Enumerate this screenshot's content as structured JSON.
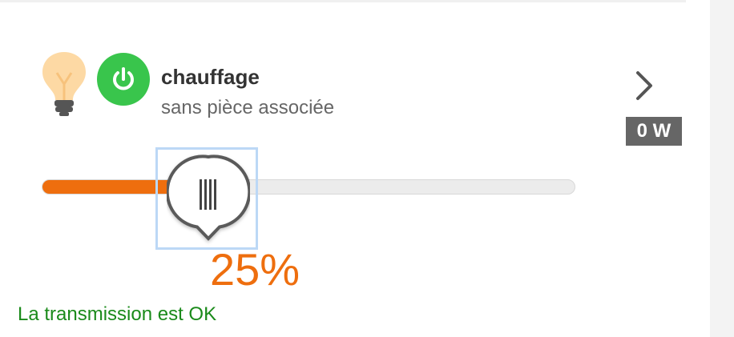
{
  "device": {
    "name": "chauffage",
    "room": "sans pièce associée",
    "power_reading": "0 W",
    "bulb_icon": "lightbulb-icon",
    "power_icon": "power-icon",
    "chevron_icon": "chevron-right-icon"
  },
  "slider": {
    "level_percent": 25,
    "value_label": "25%"
  },
  "status": {
    "text": "La transmission est OK"
  },
  "colors": {
    "power_on_green": "#39c54c",
    "slider_orange": "#ee6e0e",
    "status_green": "#1a8a1a",
    "badge_gray": "#666666",
    "focus_blue": "#bcd8f6"
  }
}
